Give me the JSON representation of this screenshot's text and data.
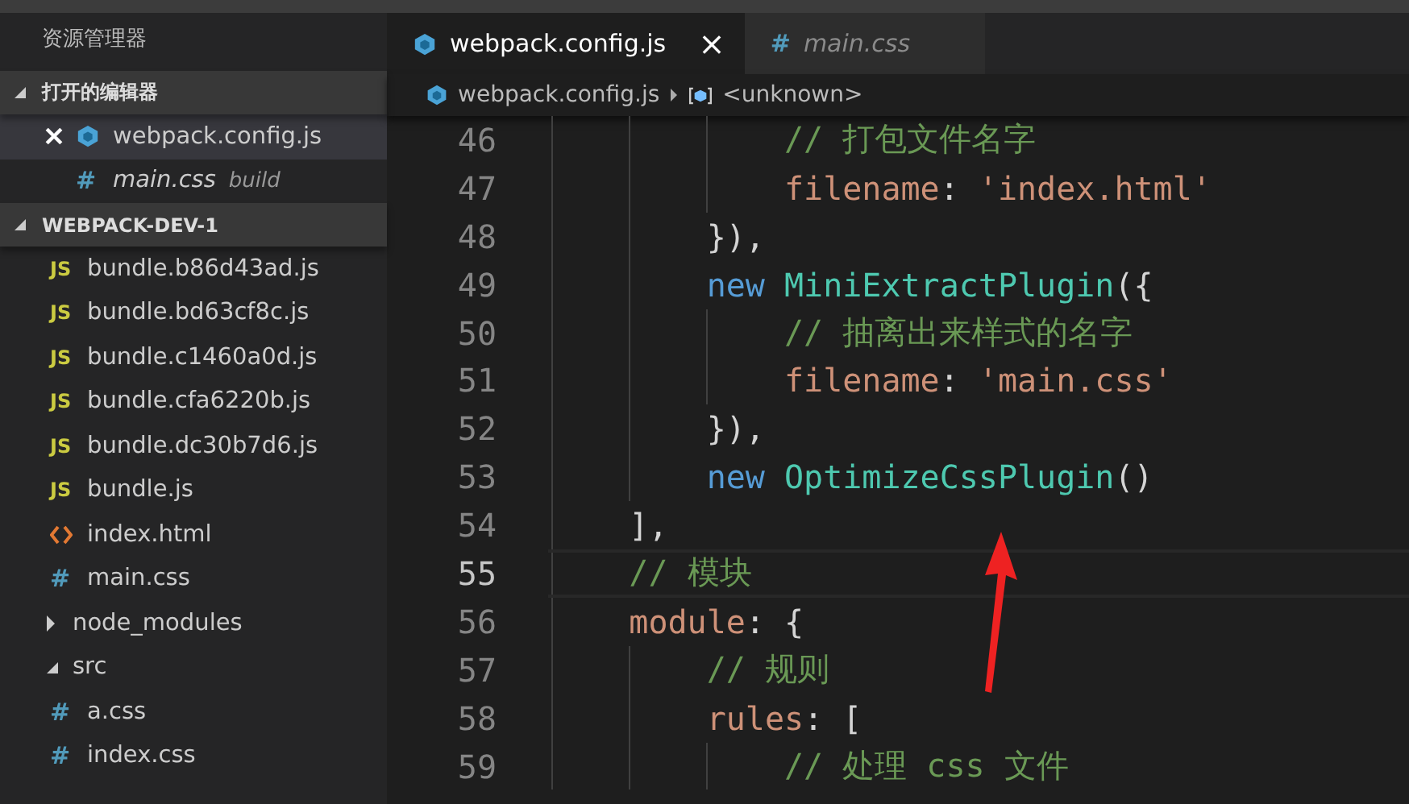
{
  "sidebar": {
    "title": "资源管理器",
    "sections": [
      {
        "title": "打开的编辑器",
        "expanded": true,
        "kind": "editors",
        "items": [
          {
            "name": "webpack.config.js",
            "kind": "webpack",
            "selected": true
          },
          {
            "name": "main.css",
            "kind": "css",
            "glyph": "#",
            "selected": false,
            "description": "build"
          }
        ]
      },
      {
        "title": "WEBPACK-DEV-1",
        "expanded": true,
        "kind": "tree",
        "items": [
          {
            "name": "bundle.b86d43ad.js",
            "kind": "js",
            "glyph": "JS"
          },
          {
            "name": "bundle.bd63cf8c.js",
            "kind": "js",
            "glyph": "JS"
          },
          {
            "name": "bundle.c1460a0d.js",
            "kind": "js",
            "glyph": "JS"
          },
          {
            "name": "bundle.cfa6220b.js",
            "kind": "js",
            "glyph": "JS"
          },
          {
            "name": "bundle.dc30b7d6.js",
            "kind": "js",
            "glyph": "JS"
          },
          {
            "name": "bundle.js",
            "kind": "js",
            "glyph": "JS"
          },
          {
            "name": "index.html",
            "kind": "html"
          },
          {
            "name": "main.css",
            "kind": "css",
            "glyph": "#"
          },
          {
            "name": "node_modules",
            "kind": "folder",
            "expanded": false
          },
          {
            "name": "src",
            "kind": "folder",
            "expanded": true,
            "children": [
              {
                "name": "a.css",
                "kind": "css",
                "glyph": "#"
              },
              {
                "name": "index.css",
                "kind": "css",
                "glyph": "#"
              }
            ]
          }
        ]
      }
    ]
  },
  "tabs": [
    {
      "label": "webpack.config.js",
      "kind": "webpack",
      "selected": true,
      "close": "×"
    },
    {
      "label": "main.css",
      "kind": "css",
      "glyph": "#",
      "selected": false
    }
  ],
  "breadcrumb": {
    "file": "webpack.config.js",
    "symbol": "<unknown>"
  },
  "editor": {
    "lines": [
      {
        "number": "46",
        "current": false,
        "tokens": [
          {
            "kind": "comment",
            "text": "            // 打包文件名字"
          }
        ]
      },
      {
        "number": "47",
        "current": false,
        "tokens": [
          {
            "kind": "prop",
            "text": "            filename"
          },
          {
            "kind": "punct",
            "text": ": "
          },
          {
            "kind": "string",
            "text": "'index.html'"
          }
        ]
      },
      {
        "number": "48",
        "current": false,
        "tokens": [
          {
            "kind": "punct",
            "text": "        }),"
          }
        ]
      },
      {
        "number": "49",
        "current": false,
        "tokens": [
          {
            "kind": "keyword",
            "text": "        new "
          },
          {
            "kind": "class",
            "text": "MiniExtractPlugin"
          },
          {
            "kind": "punct",
            "text": "({"
          }
        ]
      },
      {
        "number": "50",
        "current": false,
        "tokens": [
          {
            "kind": "comment",
            "text": "            // 抽离出来样式的名字"
          }
        ]
      },
      {
        "number": "51",
        "current": false,
        "tokens": [
          {
            "kind": "prop",
            "text": "            filename"
          },
          {
            "kind": "punct",
            "text": ": "
          },
          {
            "kind": "string",
            "text": "'main.css'"
          }
        ]
      },
      {
        "number": "52",
        "current": false,
        "tokens": [
          {
            "kind": "punct",
            "text": "        }),"
          }
        ]
      },
      {
        "number": "53",
        "current": false,
        "tokens": [
          {
            "kind": "keyword",
            "text": "        new "
          },
          {
            "kind": "class",
            "text": "OptimizeCssPlugin"
          },
          {
            "kind": "punct",
            "text": "()"
          }
        ]
      },
      {
        "number": "54",
        "current": false,
        "tokens": [
          {
            "kind": "punct",
            "text": "    ],"
          }
        ]
      },
      {
        "number": "55",
        "current": true,
        "tokens": [
          {
            "kind": "comment",
            "text": "    // 模块"
          }
        ]
      },
      {
        "number": "56",
        "current": false,
        "tokens": [
          {
            "kind": "prop",
            "text": "    module"
          },
          {
            "kind": "punct",
            "text": ": {"
          }
        ]
      },
      {
        "number": "57",
        "current": false,
        "tokens": [
          {
            "kind": "comment",
            "text": "        // 规则"
          }
        ]
      },
      {
        "number": "58",
        "current": false,
        "tokens": [
          {
            "kind": "prop",
            "text": "        rules"
          },
          {
            "kind": "punct",
            "text": ": ["
          }
        ]
      },
      {
        "number": "59",
        "current": false,
        "tokens": [
          {
            "kind": "comment",
            "text": "            // 处理 css 文件"
          }
        ]
      }
    ]
  }
}
